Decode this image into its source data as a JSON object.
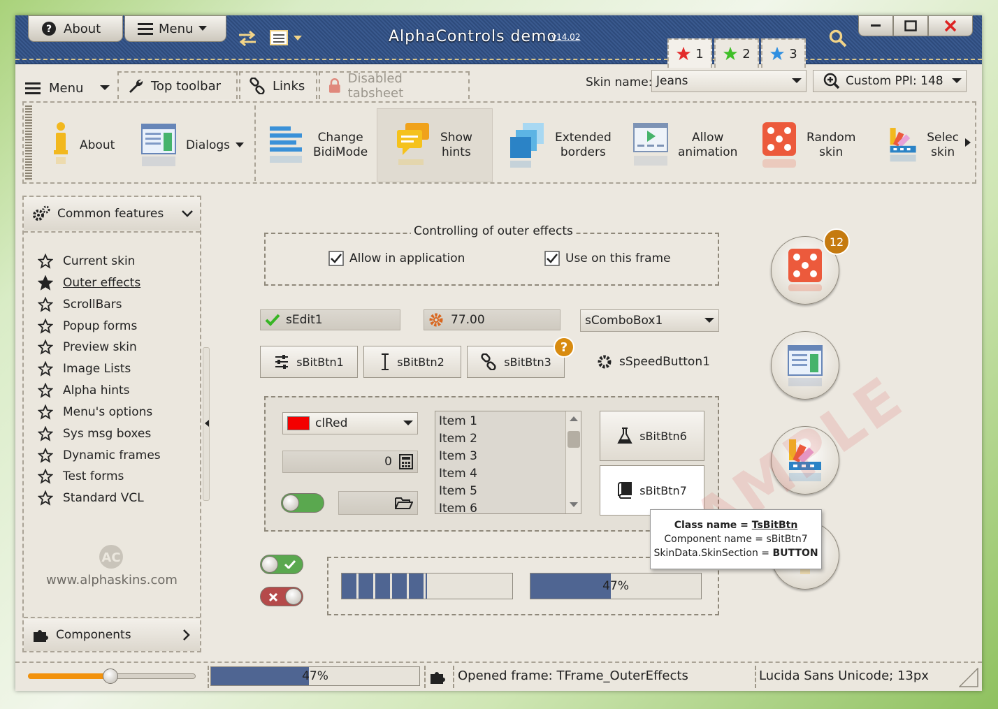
{
  "titlebar": {
    "about_label": "About",
    "menu_label": "Menu",
    "title": "AlphaControls demo",
    "version": "v14.02",
    "star_tabs": [
      {
        "label": "1",
        "color": "#e32b2b"
      },
      {
        "label": "2",
        "color": "#3fbf27"
      },
      {
        "label": "3",
        "color": "#2f8fe0"
      }
    ]
  },
  "tabs": {
    "menu_label": "Menu",
    "items": [
      "Top toolbar",
      "Links",
      "Disabled tabsheet"
    ],
    "skin_label": "Skin name:",
    "skin_value": "Jeans",
    "ppi_label": "Custom PPI: 148"
  },
  "toolbar": {
    "about": "About",
    "dialogs": "Dialogs",
    "change_bidimode": [
      "Change",
      "BidiMode"
    ],
    "show_hints": [
      "Show",
      "hints"
    ],
    "extended_borders": [
      "Extended",
      "borders"
    ],
    "allow_animation": [
      "Allow",
      "animation"
    ],
    "random_skin": [
      "Random",
      "skin"
    ],
    "select_skin": [
      "Selec",
      "skin"
    ]
  },
  "sidebar": {
    "header": "Common features",
    "items": [
      "Current skin",
      "Outer effects",
      "ScrollBars",
      "Popup forms",
      "Preview skin",
      "Image Lists",
      "Alpha hints",
      "Menu's options",
      "Sys msg boxes",
      "Dynamic frames",
      "Test forms",
      "Standard VCL"
    ],
    "site": "www.alphaskins.com",
    "footer": "Components"
  },
  "main": {
    "group_title": "Controlling of outer effects",
    "check1": "Allow in application",
    "check2": "Use on this frame",
    "edit1": "sEdit1",
    "spin_value": "77.00",
    "combo1": "sComboBox1",
    "btn1": "sBitBtn1",
    "btn2": "sBitBtn2",
    "btn3": "sBitBtn3",
    "speed_btn": "sSpeedButton1",
    "color_combo": "clRed",
    "calc_value": "0",
    "list_items": [
      "Item 1",
      "Item 2",
      "Item 3",
      "Item 4",
      "Item 5",
      "Item 6"
    ],
    "btn6": "sBitBtn6",
    "btn7": "sBitBtn7",
    "badge_count": "12",
    "gauge_value": "47%",
    "segment_progress": 0.5,
    "bar_progress": 0.47
  },
  "hint": {
    "line1_label": "Class name = ",
    "line1_value": "TsBitBtn",
    "line2": "Component name = sBitBtn7",
    "line3_label": "SkinData.SkinSection = ",
    "line3_value": "BUTTON"
  },
  "statusbar": {
    "progress_text": "47%",
    "progress_value": 0.47,
    "trackbar_value": 0.49,
    "frame_text": "Opened frame: TFrame_OuterEffects",
    "font_text": "Lucida Sans Unicode; 13px"
  },
  "watermark": "SAMPLE"
}
